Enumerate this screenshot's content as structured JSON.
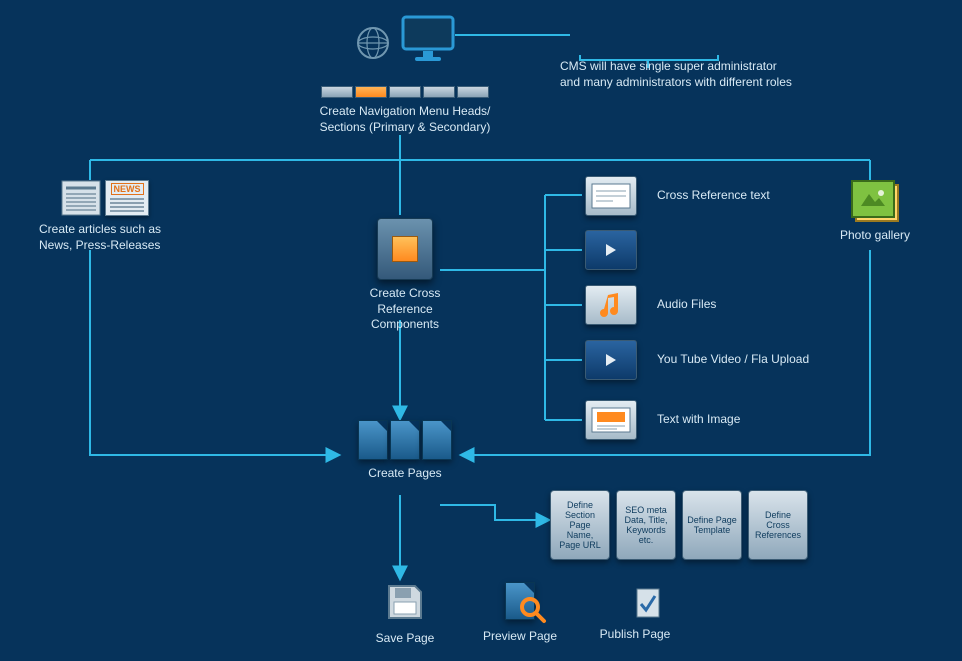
{
  "top": {
    "nav_label": "Create Navigation Menu Heads/\nSections (Primary & Secondary)",
    "admins_label": "CMS will have single super administrator\nand many administrators with different roles"
  },
  "left": {
    "articles_label": "Create articles such as\nNews, Press-Releases",
    "news_badge": "NEWS"
  },
  "center": {
    "cross_ref_label": "Create Cross Reference\nComponents",
    "create_pages_label": "Create Pages"
  },
  "components": {
    "text": "Cross Reference text",
    "video": "",
    "audio": "Audio Files",
    "youtube": "You Tube Video / Fla Upload",
    "text_image": "Text with Image"
  },
  "right": {
    "gallery_label": "Photo gallery"
  },
  "cards": {
    "c1": "Define Section Page Name, Page URL",
    "c2": "SEO meta Data, Title, Keywords etc.",
    "c3": "Define Page Template",
    "c4": "Define Cross References"
  },
  "bottom": {
    "save": "Save Page",
    "preview": "Preview Page",
    "publish": "Publish Page"
  }
}
